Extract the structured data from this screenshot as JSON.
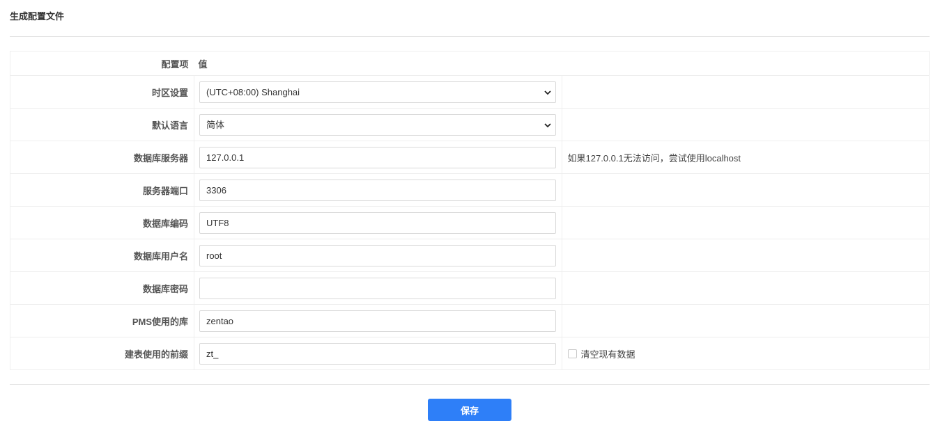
{
  "page": {
    "title": "生成配置文件"
  },
  "table": {
    "header": {
      "label": "配置项",
      "value": "值"
    },
    "rows": {
      "timezone": {
        "label": "时区设置",
        "value": "(UTC+08:00) Shanghai"
      },
      "language": {
        "label": "默认语言",
        "value": "简体"
      },
      "db_host": {
        "label": "数据库服务器",
        "value": "127.0.0.1",
        "note": "如果127.0.0.1无法访问，尝试使用localhost"
      },
      "db_port": {
        "label": "服务器端口",
        "value": "3306"
      },
      "db_encoding": {
        "label": "数据库编码",
        "value": "UTF8"
      },
      "db_user": {
        "label": "数据库用户名",
        "value": "root"
      },
      "db_password": {
        "label": "数据库密码",
        "value": ""
      },
      "db_name": {
        "label": "PMS使用的库",
        "value": "zentao"
      },
      "db_prefix": {
        "label": "建表使用的前缀",
        "value": "zt_",
        "checkbox_label": "清空现有数据",
        "checkbox_checked": false
      }
    }
  },
  "actions": {
    "save_label": "保存"
  },
  "colors": {
    "primary": "#2e7ff8",
    "border": "#eeeeee"
  }
}
